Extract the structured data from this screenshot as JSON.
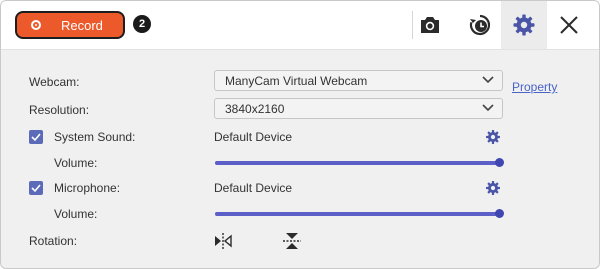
{
  "record": {
    "label": "Record"
  },
  "step_badge": "2",
  "toolbar": {
    "icons": [
      "camera-icon",
      "schedule-icon",
      "settings-icon",
      "close-icon"
    ]
  },
  "settings": {
    "webcam": {
      "label": "Webcam:",
      "value": "ManyCam Virtual Webcam",
      "link": "Property"
    },
    "resolution": {
      "label": "Resolution:",
      "value": "3840x2160"
    },
    "system_sound": {
      "label": "System Sound:",
      "checked": true,
      "device": "Default Device",
      "volume_label": "Volume:",
      "volume": 1.0
    },
    "microphone": {
      "label": "Microphone:",
      "checked": true,
      "device": "Default Device",
      "volume_label": "Volume:",
      "volume": 1.0
    },
    "rotation": {
      "label": "Rotation:",
      "icons": [
        "flip-horizontal-icon",
        "flip-vertical-icon"
      ]
    }
  },
  "colors": {
    "record_button": "#ec5a2c",
    "accent": "#5b6bb8",
    "link": "#4a63c8"
  }
}
